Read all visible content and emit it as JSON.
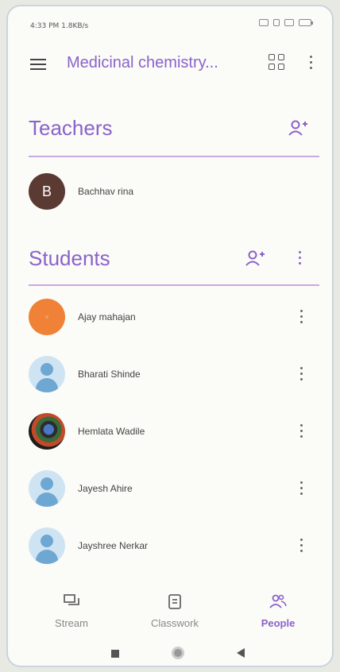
{
  "status_bar": {
    "time_speed": "4:33 PM  1.8KB/s"
  },
  "app_bar": {
    "title": "Medicinal chemistry...",
    "menu_icon": "hamburger-menu-icon",
    "grid_icon": "classroom-apps-icon",
    "more_icon": "more-vert-icon"
  },
  "teachers": {
    "heading": "Teachers",
    "add_icon": "add-person-icon",
    "items": [
      {
        "name": "Bachhav rina",
        "avatar_letter": "B"
      }
    ]
  },
  "students": {
    "heading": "Students",
    "add_icon": "add-person-icon",
    "more_icon": "more-vert-icon",
    "items": [
      {
        "name": "Ajay mahajan",
        "avatar": "orange"
      },
      {
        "name": "Bharati Shinde",
        "avatar": "default"
      },
      {
        "name": "Hemlata Wadile",
        "avatar": "photo"
      },
      {
        "name": "Jayesh Ahire",
        "avatar": "default"
      },
      {
        "name": "Jayshree Nerkar",
        "avatar": "default"
      }
    ]
  },
  "bottom_nav": {
    "items": [
      {
        "label": "Stream",
        "icon": "stream-icon",
        "active": false
      },
      {
        "label": "Classwork",
        "icon": "classwork-icon",
        "active": false
      },
      {
        "label": "People",
        "icon": "people-icon",
        "active": true
      }
    ]
  },
  "colors": {
    "accent": "#8a63c9",
    "divider": "#caa8e0",
    "teacher_avatar": "#5a3a32",
    "student_avatar_orange": "#f08237",
    "default_avatar_bg": "#cfe4f2"
  }
}
